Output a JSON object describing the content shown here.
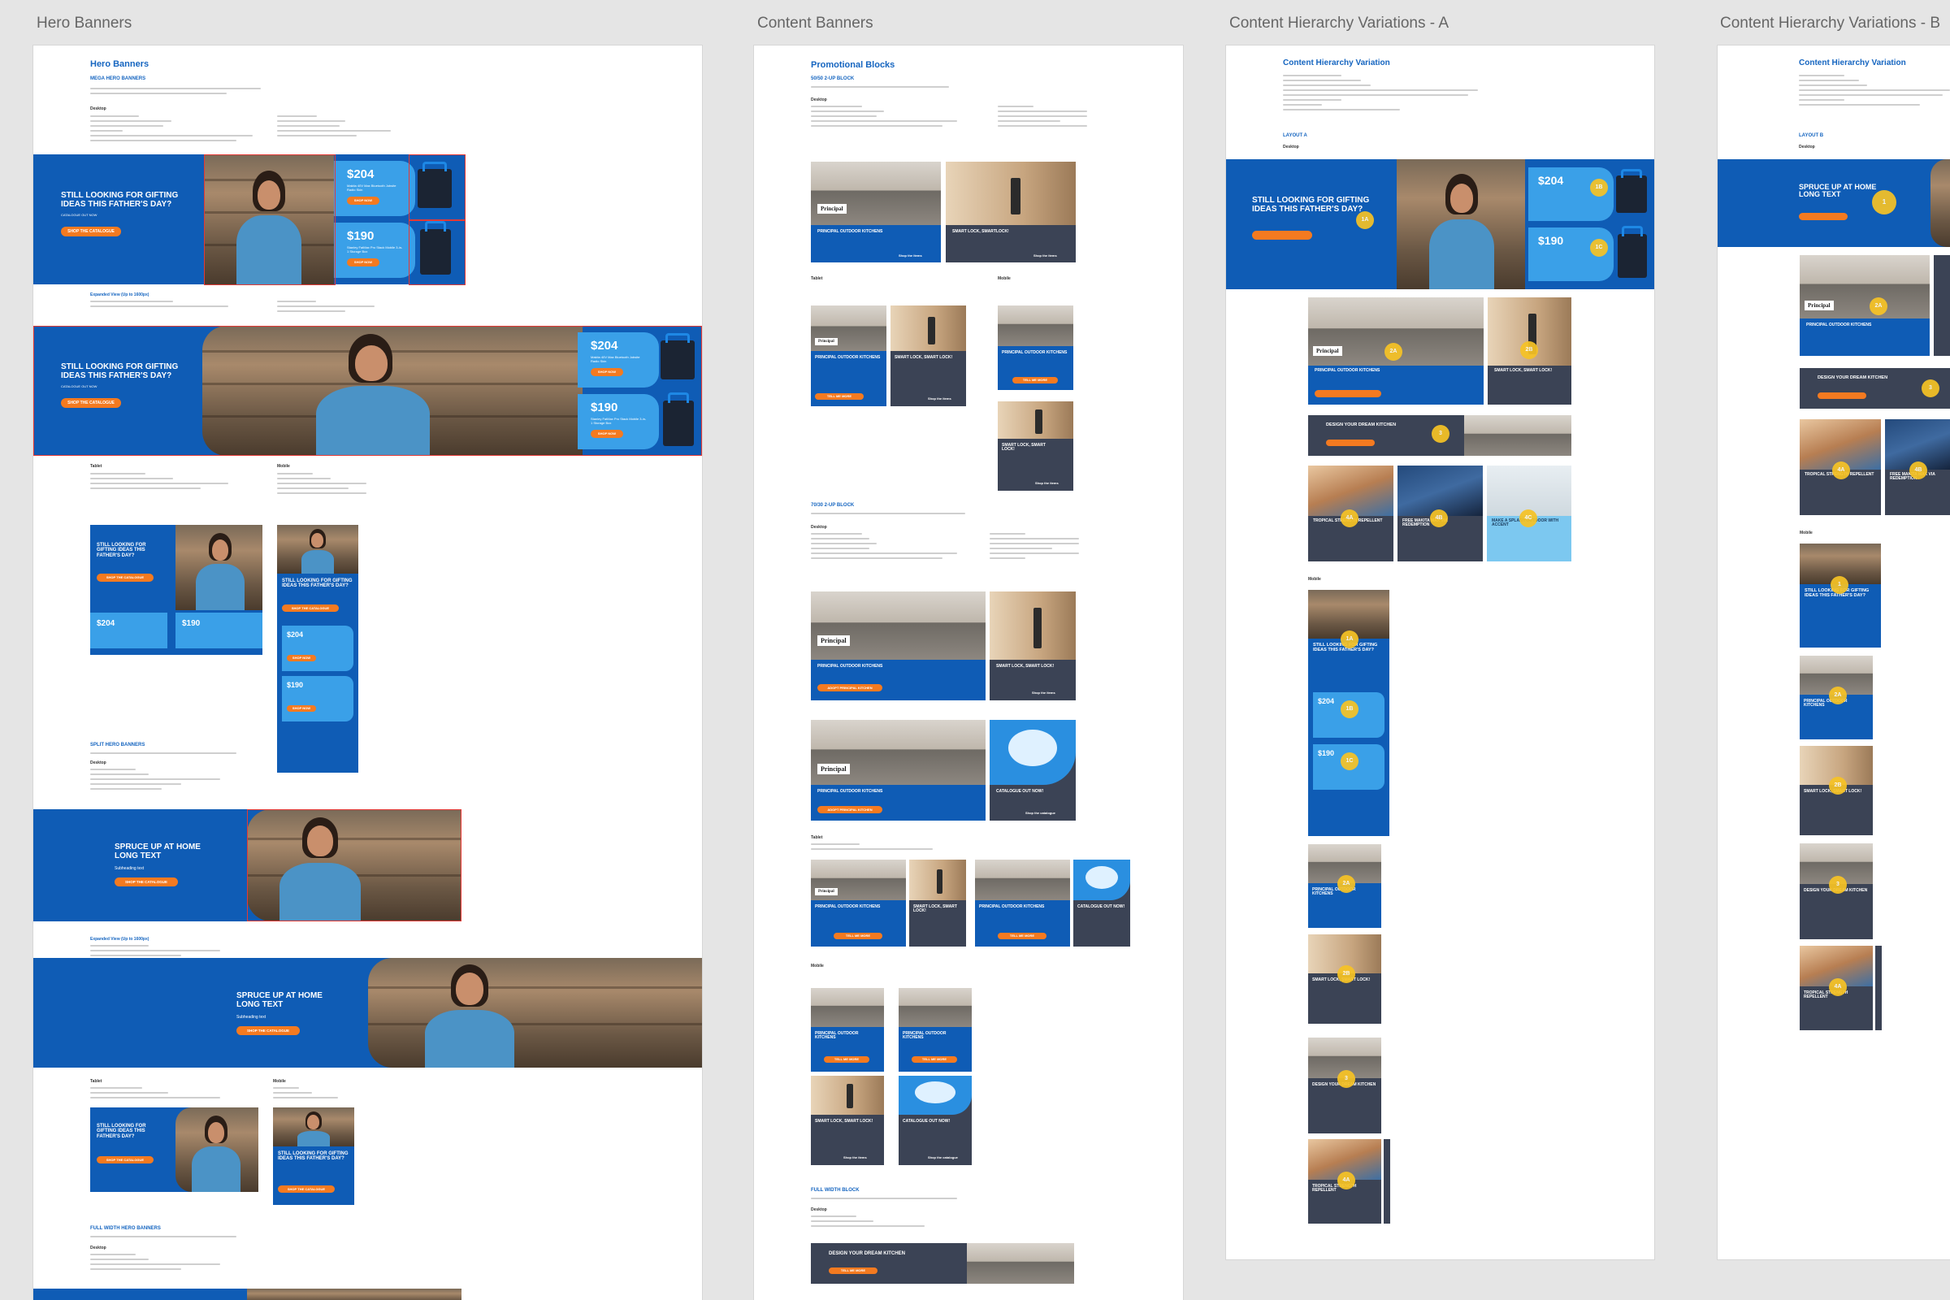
{
  "artboards": [
    {
      "label": "Hero Banners"
    },
    {
      "label": "Content Banners"
    },
    {
      "label": "Content Hierarchy Variations - A"
    },
    {
      "label": "Content Hierarchy Variations - B"
    }
  ],
  "hero": {
    "title": "Hero Banners",
    "mega": "MEGA HERO BANNERS",
    "desktop": "Desktop",
    "expanded": "Expanded View (Up to 1600px)",
    "tablet": "Tablet",
    "mobile": "Mobile",
    "split": "SPLIT HERO BANNERS",
    "fullwidth": "FULL WIDTH HERO BANNERS",
    "headline": "STILL LOOKING FOR GIFTING IDEAS THIS FATHER'S DAY?",
    "sub": "CATALOGUE OUT NOW",
    "cta": "SHOP THE CATALOGUE",
    "price1": "$204",
    "price1cents": ".00",
    "price1desc": "Makita 40V Max Bluetooth Jobsite Radio Skin",
    "price2": "$190",
    "price2desc": "Stanley FatMax Pro Stack Mobile 3-in-1 Storage Box",
    "shop": "SHOP NOW",
    "spruce": "SPRUCE UP AT HOME LONG TEXT",
    "spruceSub": "Subheading text"
  },
  "content": {
    "title": "Promotional Blocks",
    "block5050": "50/50 2-UP BLOCK",
    "block7030": "70/30 2-UP BLOCK",
    "full": "FULL WIDTH BLOCK",
    "desktop": "Desktop",
    "tablet": "Tablet",
    "mobile": "Mobile",
    "principal": "PRINCIPAL OUTDOOR KITCHENS",
    "principalShort": "PRINCIPAL OUTDOOR KITCHENS",
    "smartlock": "SMART LOCK, SMARTLOCK!",
    "smartlock2": "SMART LOCK, SMART LOCK!",
    "catalogue": "CATALOGUE OUT NOW!",
    "dream": "DESIGN YOUR DREAM KITCHEN",
    "tellMore": "TELL ME MORE",
    "adopt": "ADOPT PRINCIPAL KITCHEN",
    "shopItems": "Shop the items",
    "viewCatalogue": "Shop the catalogue",
    "logo": "Principal"
  },
  "varA": {
    "title": "Content Hierarchy Variation",
    "layout": "LAYOUT A",
    "desktop": "Desktop",
    "mobile": "Mobile",
    "headline": "STILL LOOKING FOR GIFTING IDEAS THIS FATHER'S DAY?",
    "principal": "PRINCIPAL OUTDOOR KITCHENS",
    "smartlock": "SMART LOCK, SMART LOCK!",
    "dream": "DESIGN YOUR DREAM KITCHEN",
    "tropical": "TROPICAL STRENGTH REPELLENT",
    "free": "FREE MAKITA MAX VIA REDEMPTION",
    "make": "MAKE A SPLASH OUTDOOR WITH ACCENT",
    "price1": "$204",
    "price2": "$190",
    "badges": [
      "1A",
      "1B",
      "1C",
      "2A",
      "2B",
      "3",
      "4A",
      "4B",
      "4C"
    ]
  },
  "varB": {
    "title": "Content Hierarchy Variation",
    "layout": "LAYOUT B",
    "desktop": "Desktop",
    "mobile": "Mobile",
    "headline": "SPRUCE UP AT HOME LONG TEXT",
    "principal": "PRINCIPAL OUTDOOR KITCHENS",
    "dream": "DESIGN YOUR DREAM KITCHEN",
    "tropical": "TROPICAL STRENGTH REPELLENT",
    "free": "FREE MAKITA MAX VIA REDEMPTION",
    "badges": [
      "1",
      "2A",
      "2B",
      "3",
      "4A",
      "4B"
    ]
  }
}
